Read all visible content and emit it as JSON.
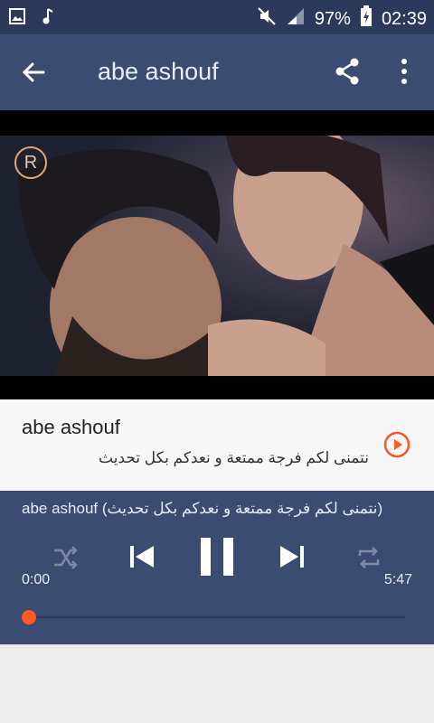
{
  "status": {
    "battery": "97%",
    "time": "02:39",
    "icons": [
      "image-icon",
      "music-icon",
      "mute-icon",
      "signal-icon",
      "battery-charging-icon"
    ]
  },
  "appbar": {
    "title": "abe ashouf",
    "back_icon": "arrow-back-icon",
    "share_icon": "share-icon",
    "more_icon": "more-vert-icon"
  },
  "video": {
    "watermark": "R"
  },
  "track": {
    "title": "abe ashouf",
    "subtitle": "نتمنى لكم فرجة ممتعة و نعدكم بكل تحديث",
    "play_icon": "play-circle-icon"
  },
  "player": {
    "now_playing": "abe ashouf (نتمنى لكم فرجة ممتعة و نعدكم بكل تحديث)",
    "time_current": "0:00",
    "time_total": "5:47",
    "progress": 0.0,
    "controls": [
      "shuffle-icon",
      "skip-previous-icon",
      "pause-icon",
      "skip-next-icon",
      "repeat-icon"
    ]
  },
  "colors": {
    "statusbar": "#2b3a5a",
    "primary": "#3b4c72",
    "accent": "#ff5722"
  }
}
